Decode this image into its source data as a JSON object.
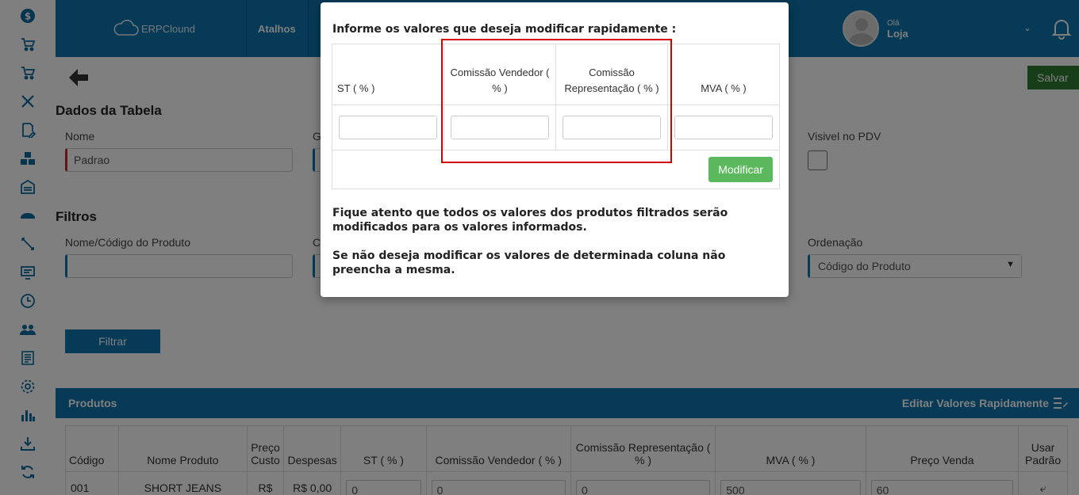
{
  "sidebar": {
    "icons": [
      "dollar-icon",
      "cart-icon",
      "cart-icon",
      "tools-icon",
      "file-edit-icon",
      "boxes-icon",
      "warehouse-icon",
      "truck-icon",
      "pencil-icon",
      "monitor-icon",
      "clock-icon",
      "users-icon",
      "report-icon",
      "gear-icon",
      "bar-chart-icon",
      "download-icon",
      "sync-icon"
    ]
  },
  "topbar": {
    "logo_text": "ERPClound",
    "shortcuts_label": "Atalhos",
    "greeting": "Olá",
    "user_name": "Loja"
  },
  "page": {
    "save_label": "Salvar",
    "table_section_title": "Dados da Tabela",
    "name_label": "Nome",
    "name_value": "Padrao",
    "second_label_partial": "G",
    "pdv_label": "Visivel no PDV",
    "filters_title": "Filtros",
    "product_filter_label": "Nome/Código do Produto",
    "product_filter_value": "",
    "category_label_partial": "C",
    "order_label": "Ordenação",
    "order_value": "Código do Produto",
    "filter_button": "Filtrar"
  },
  "products": {
    "section_title": "Produtos",
    "quick_edit_label": "Editar Valores Rapidamente",
    "columns": [
      "Código",
      "Nome Produto",
      "Preço Custo",
      "Despesas",
      "ST ( % )",
      "Comissão Vendedor ( % )",
      "Comissão Representação ( % )",
      "MVA ( % )",
      "Preço Venda",
      "Usar Padrão"
    ],
    "rows": [
      {
        "codigo": "001",
        "nome": "SHORT JEANS",
        "custo": "R$",
        "despesas": "R$ 0,00",
        "st": "0",
        "comissao_vendedor": "0",
        "comissao_representacao": "0",
        "mva": "500",
        "preco_venda": "60"
      }
    ]
  },
  "modal": {
    "heading": "Informe os valores que deseja modificar rapidamente :",
    "columns": [
      "ST ( % )",
      "Comissão Vendedor ( % )",
      "Comissão Representação ( % )",
      "MVA ( % )"
    ],
    "inputs": [
      "",
      "",
      "",
      ""
    ],
    "submit_label": "Modificar",
    "notice_1": "Fique atento que todos os valores dos produtos filtrados serão modificados para os valores informados.",
    "notice_2": "Se não deseja modificar os valores de determinada coluna não preencha a mesma."
  },
  "colors": {
    "brand_blue": "#0c74ad",
    "save_green": "#2e7d32",
    "modify_green": "#5cb85c",
    "highlight_red": "#d40000"
  }
}
